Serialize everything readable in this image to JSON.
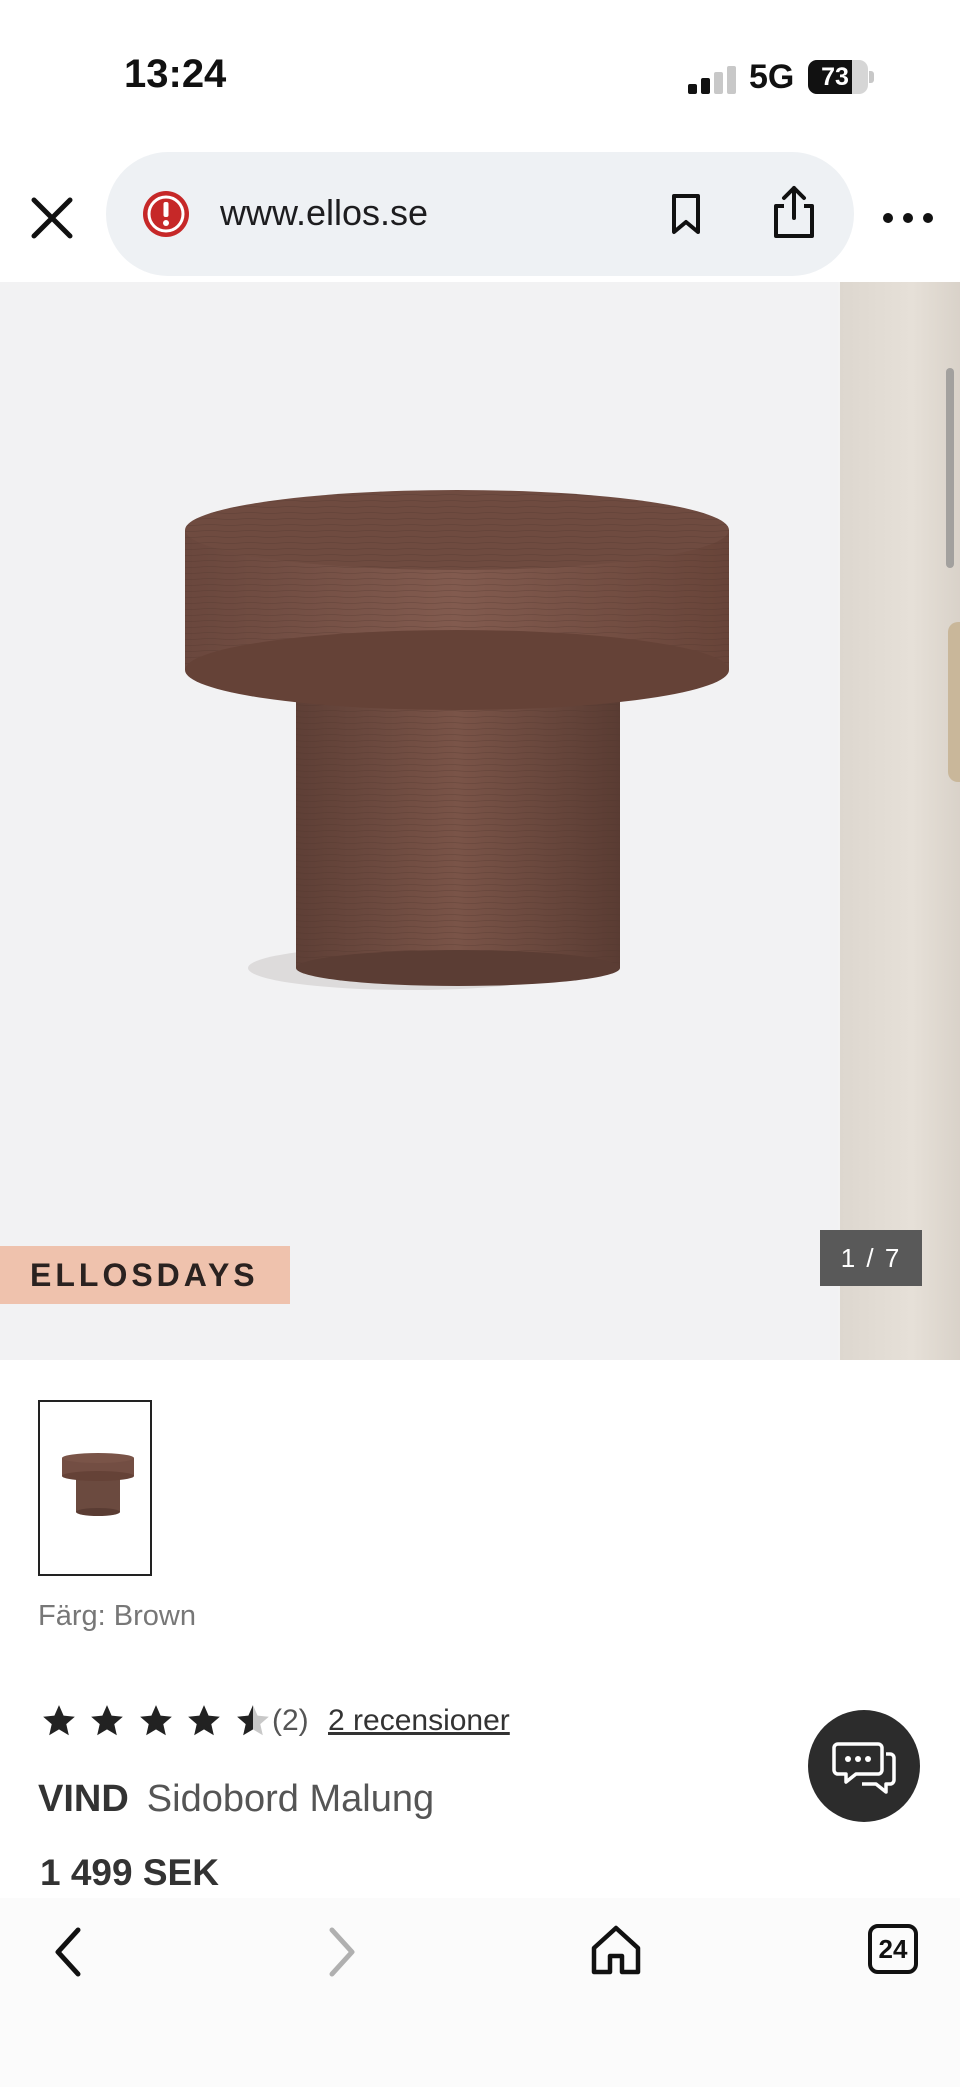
{
  "status_bar": {
    "time": "13:24",
    "network": "5G",
    "battery": "73",
    "battery_level": 0.73
  },
  "browser": {
    "url": "www.ellos.se"
  },
  "gallery": {
    "promo_badge": "ELLOSDAYS",
    "image_counter": "1 / 7",
    "product_color": "#6b4a3f"
  },
  "product": {
    "color_label": "Färg: Brown",
    "rating": 4.5,
    "rating_count": "(2)",
    "reviews_link": "2 recensioner",
    "brand": "VIND",
    "name": "Sidobord Malung",
    "price": "1 499 SEK"
  },
  "toolbar": {
    "tab_count": "24"
  },
  "icons": [
    "close-icon",
    "security-warning-icon",
    "bookmark-icon",
    "share-icon",
    "more-icon",
    "chat-icon",
    "back-icon",
    "forward-icon",
    "home-icon",
    "tabs-icon"
  ]
}
